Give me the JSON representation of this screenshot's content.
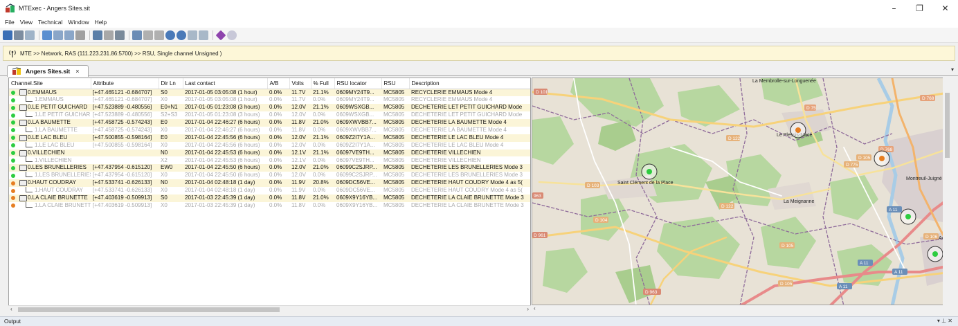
{
  "window": {
    "title": "MTExec - Angers Sites.sit",
    "minimize": "–",
    "restore": "❐",
    "close": "✕"
  },
  "menu": [
    "File",
    "View",
    "Technical",
    "Window",
    "Help"
  ],
  "toolbar": {
    "icons": [
      "save-icon",
      "print-icon",
      "preview-icon",
      "network-icon",
      "import-icon",
      "export-icon",
      "refresh-icon",
      "chart-icon",
      "swap-icon",
      "user-icon",
      "zoom-icon",
      "pan-icon",
      "ruler-icon",
      "back-icon",
      "forward-icon",
      "layer-icon",
      "table-icon",
      "diamond-icon",
      "globe-icon"
    ]
  },
  "navbar": {
    "path": "MTE >> Network, RAS (111.223.231.86:5700) >> RSU, Single channel Unsigned )"
  },
  "doc_tab": {
    "label": "Angers Sites.sit",
    "close": "×",
    "overflow": "▾"
  },
  "table": {
    "columns": [
      "Channel.Site",
      "Attribute",
      "Dir Ln",
      "Last contact",
      "A/B",
      "Volts",
      "% Full",
      "RSU locator",
      "RSU",
      "Description"
    ],
    "rows": [
      {
        "kind": "main",
        "alt": true,
        "status": "#2ecc40",
        "site": "0.EMMAUS",
        "attribute": "[+47.465121 -0.684707]",
        "dir": "S0",
        "last": "2017-01-05 03:05:08 (1 hour)",
        "ab": "0.0%",
        "volts": "11.7V",
        "full": "21.1%",
        "locator": "0609MY24T9...",
        "rsu": "MC5805",
        "desc": "RECYCLERIE EMMAUS Mode 4"
      },
      {
        "kind": "sub",
        "alt": false,
        "status": "#2ecc40",
        "site": "1.EMMAUS",
        "attribute": "[+47.465121 -0.684707]",
        "dir": "X0",
        "last": "2017-01-05 03:05:08 (1 hour)",
        "ab": "0.0%",
        "volts": "11.7V",
        "full": "0.0%",
        "locator": "0609MY24T9...",
        "rsu": "MC5805",
        "desc": "RECYCLERIE EMMAUS Mode 4"
      },
      {
        "kind": "main",
        "alt": true,
        "status": "#2ecc40",
        "site": "0.LE PETIT GUICHARD",
        "attribute": "[+47.523889 -0.480556]",
        "dir": "E0+N1",
        "last": "2017-01-05 01:23:08 (3 hours)",
        "ab": "0.0%",
        "volts": "12.0V",
        "full": "21.1%",
        "locator": "0609WSXGB...",
        "rsu": "MC5805",
        "desc": "DECHETERIE LET PETIT GUICHARD Mode"
      },
      {
        "kind": "sub",
        "alt": false,
        "status": "#2ecc40",
        "site": "1.LE PETIT GUICHARD",
        "attribute": "[+47.523889 -0.480556]",
        "dir": "S2+S3",
        "last": "2017-01-05 01:23:08 (3 hours)",
        "ab": "0.0%",
        "volts": "12.0V",
        "full": "0.0%",
        "locator": "0609WSXGB...",
        "rsu": "MC5805",
        "desc": "DECHETERIE LET PETIT GUICHARD Mode"
      },
      {
        "kind": "main",
        "alt": true,
        "status": "#2ecc40",
        "site": "0.LA BAUMETTE",
        "attribute": "[+47.458725 -0.574243]",
        "dir": "E0",
        "last": "2017-01-04 22:46:27 (6 hours)",
        "ab": "0.0%",
        "volts": "11.8V",
        "full": "21.0%",
        "locator": "0609XWVBB7...",
        "rsu": "MC5805",
        "desc": "DECHETERIE LA BAUMETTE Mode 4"
      },
      {
        "kind": "sub",
        "alt": false,
        "status": "#2ecc40",
        "site": "1.LA BAUMETTE",
        "attribute": "[+47.458725 -0.574243]",
        "dir": "X0",
        "last": "2017-01-04 22:46:27 (6 hours)",
        "ab": "0.0%",
        "volts": "11.8V",
        "full": "0.0%",
        "locator": "0609XWVBB7...",
        "rsu": "MC5805",
        "desc": "DECHETERIE LA BAUMETTE Mode 4"
      },
      {
        "kind": "main",
        "alt": true,
        "status": "#2ecc40",
        "site": "0.LE LAC BLEU",
        "attribute": "[+47.500855 -0.598164]",
        "dir": "E0",
        "last": "2017-01-04 22:45:56 (6 hours)",
        "ab": "0.0%",
        "volts": "12.0V",
        "full": "21.1%",
        "locator": "0609Z2I7Y1A...",
        "rsu": "MC5805",
        "desc": "DECHETERIE LE LAC BLEU Mode 4"
      },
      {
        "kind": "sub",
        "alt": false,
        "status": "#2ecc40",
        "site": "1.LE LAC BLEU",
        "attribute": "[+47.500855 -0.598164]",
        "dir": "X0",
        "last": "2017-01-04 22:45:56 (6 hours)",
        "ab": "0.0%",
        "volts": "12.0V",
        "full": "0.0%",
        "locator": "0609Z2I7Y1A...",
        "rsu": "MC5805",
        "desc": "DECHETERIE LE LAC BLEU Mode 4"
      },
      {
        "kind": "main",
        "alt": true,
        "status": "#2ecc40",
        "site": "0.VILLECHIEN",
        "attribute": "",
        "dir": "N0",
        "last": "2017-01-04 22:45:53 (6 hours)",
        "ab": "0.0%",
        "volts": "12.1V",
        "full": "21.1%",
        "locator": "06097VE9TH...",
        "rsu": "MC5805",
        "desc": "DECHETERIE VILLECHIEN"
      },
      {
        "kind": "sub",
        "alt": false,
        "status": "#2ecc40",
        "site": "1.VILLECHIEN",
        "attribute": "",
        "dir": "X2",
        "last": "2017-01-04 22:45:53 (6 hours)",
        "ab": "0.0%",
        "volts": "12.1V",
        "full": "0.0%",
        "locator": "06097VE9TH...",
        "rsu": "MC5805",
        "desc": "DECHETERIE VILLECHIEN"
      },
      {
        "kind": "main",
        "alt": true,
        "status": "#2ecc40",
        "site": "0.LES BRUNELLERIES",
        "attribute": "[+47.437954 -0.615120]",
        "dir": "EW0",
        "last": "2017-01-04 22:45:50 (6 hours)",
        "ab": "0.0%",
        "volts": "12.0V",
        "full": "21.0%",
        "locator": "06099C2SJRP...",
        "rsu": "MC5805",
        "desc": "DECHETERIE LES BRUNELLERIES Mode 3"
      },
      {
        "kind": "sub",
        "alt": false,
        "status": "#2ecc40",
        "site": "1.LES BRUNELLERIES",
        "attribute": "[+47.437954 -0.615120]",
        "dir": "X0",
        "last": "2017-01-04 22:45:50 (6 hours)",
        "ab": "0.0%",
        "volts": "12.0V",
        "full": "0.0%",
        "locator": "06099C2SJRP...",
        "rsu": "MC5805",
        "desc": "DECHETERIE LES BRUNELLERIES Mode 3"
      },
      {
        "kind": "main",
        "alt": true,
        "status": "#e67e22",
        "site": "0.HAUT COUDRAY",
        "attribute": "[+47.533741 -0.626133]",
        "dir": "N0",
        "last": "2017-01-04 02:48:18 (1 day)",
        "ab": "0.0%",
        "volts": "11.9V",
        "full": "20.8%",
        "locator": "0609DC56VE...",
        "rsu": "MC5805",
        "desc": "DECHETERIE HAUT COUDRY Mode 4 as 5("
      },
      {
        "kind": "sub",
        "alt": false,
        "status": "#e67e22",
        "site": "1.HAUT COUDRAY",
        "attribute": "[+47.533741 -0.626133]",
        "dir": "X0",
        "last": "2017-01-04 02:48:18 (1 day)",
        "ab": "0.0%",
        "volts": "11.9V",
        "full": "0.0%",
        "locator": "0609DC56VE...",
        "rsu": "MC5805",
        "desc": "DECHETERIE HAUT COUDRY Mode 4 as 5("
      },
      {
        "kind": "main",
        "alt": true,
        "status": "#e67e22",
        "site": "0.LA CLAIE BRUNETTE",
        "attribute": "[+47.403619 -0.509913]",
        "dir": "S0",
        "last": "2017-01-03 22:45:39 (1 day)",
        "ab": "0.0%",
        "volts": "11.8V",
        "full": "21.0%",
        "locator": "0609X9Y16YB...",
        "rsu": "MC5805",
        "desc": "DECHETERIE LA CLAIE BRUNETTE Mode 3"
      },
      {
        "kind": "sub",
        "alt": false,
        "status": "#e67e22",
        "site": "1.LA CLAIE BRUNETTE",
        "attribute": "[+47.403619 -0.509913]",
        "dir": "X0",
        "last": "2017-01-03 22:45:39 (1 day)",
        "ab": "0.0%",
        "volts": "11.8V",
        "full": "0.0%",
        "locator": "0609X9Y16YB...",
        "rsu": "MC5805",
        "desc": "DECHETERIE LA CLAIE BRUNETTE Mode 3"
      }
    ]
  },
  "map": {
    "places": [
      "La Membrolle-sur-Longuenée",
      "Le Plessis-Macé",
      "Saint Clément de la Place",
      "La Meignanne",
      "Montreuil-Juigné",
      "Avr"
    ],
    "roads": [
      "D 101",
      "D 75",
      "D 768",
      "D 122",
      "D 105",
      "D 775",
      "D 103",
      "963",
      "D 104",
      "D 961",
      "D 106",
      "D 105",
      "D 963",
      "A 11",
      "A 11",
      "D 105",
      "A 11"
    ],
    "markers": [
      {
        "color": "#2ecc40"
      },
      {
        "color": "#e67e22"
      },
      {
        "color": "#e67e22"
      },
      {
        "color": "#2ecc40"
      },
      {
        "color": "#2ecc40"
      }
    ]
  },
  "output": {
    "label": "Output",
    "controls": "▾ ⊥ ✕"
  }
}
